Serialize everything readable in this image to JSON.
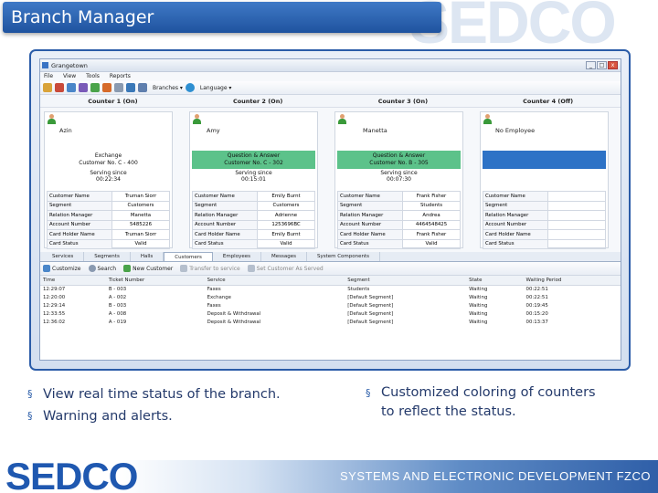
{
  "header": {
    "title": "Branch Manager",
    "watermark": "SEDCO"
  },
  "app": {
    "window_title": "Grangetown",
    "window_buttons": [
      "_",
      "□",
      "x"
    ],
    "menu": [
      "File",
      "View",
      "Tools",
      "Reports"
    ],
    "toolbar": {
      "branches": "Branches ▾",
      "language": "Language ▾"
    },
    "counters": [
      "Counter 1 (On)",
      "Counter 2 (On)",
      "Counter 3 (On)",
      "Counter 4 (Off)"
    ],
    "panels": [
      {
        "name": "Azin",
        "status_lines": [
          "Exchange",
          "Customer No. C - 400"
        ],
        "status_color": "#ffffff",
        "serving_label": "Serving since",
        "serving_time": "00:22:34",
        "rows": [
          [
            "Customer Name",
            "Truman Siorr"
          ],
          [
            "Segment",
            "Customers"
          ],
          [
            "Relation Manager",
            "Manetta"
          ],
          [
            "Account Number",
            "5485226"
          ],
          [
            "Card Holder Name",
            "Truman Siorr"
          ],
          [
            "Card Status",
            "Valid"
          ]
        ]
      },
      {
        "name": "Amy",
        "status_lines": [
          "Question & Answer",
          "Customer No. C - 302"
        ],
        "status_color": "#5cc28a",
        "serving_label": "Serving since",
        "serving_time": "00:15:01",
        "rows": [
          [
            "Customer Name",
            "Emily Burnt"
          ],
          [
            "Segment",
            "Customers"
          ],
          [
            "Relation Manager",
            "Adrienne"
          ],
          [
            "Account Number",
            "1253696BC"
          ],
          [
            "Card Holder Name",
            "Emily Burnt"
          ],
          [
            "Card Status",
            "Valid"
          ]
        ]
      },
      {
        "name": "Manetta",
        "status_lines": [
          "Question & Answer",
          "Customer No. B - 305"
        ],
        "status_color": "#5cc28a",
        "serving_label": "Serving since",
        "serving_time": "00:07:30",
        "rows": [
          [
            "Customer Name",
            "Frank Fisher"
          ],
          [
            "Segment",
            "Students"
          ],
          [
            "Relation Manager",
            "Andrea"
          ],
          [
            "Account Number",
            "4464548425"
          ],
          [
            "Card Holder Name",
            "Frank Fisher"
          ],
          [
            "Card Status",
            "Valid"
          ]
        ]
      },
      {
        "name": "No Employee",
        "status_lines": [
          "",
          ""
        ],
        "status_color": "#2d72c6",
        "serving_label": "",
        "serving_time": "",
        "rows": [
          [
            "Customer Name",
            ""
          ],
          [
            "Segment",
            ""
          ],
          [
            "Relation Manager",
            ""
          ],
          [
            "Account Number",
            ""
          ],
          [
            "Card Holder Name",
            ""
          ],
          [
            "Card Status",
            ""
          ]
        ]
      }
    ],
    "tabs": [
      "Services",
      "Segments",
      "Halls",
      "Customers",
      "Employees",
      "Messages",
      "System Components"
    ],
    "active_tab": "Customers",
    "commands": [
      "Customize",
      "Search",
      "New Customer",
      "Transfer to service",
      "Set Customer As Served"
    ],
    "grid": {
      "columns": [
        "Time",
        "Ticket Number",
        "Service",
        "Segment",
        "State",
        "Waiting Period"
      ],
      "rows": [
        [
          "12:29:07",
          "B - 003",
          "Faxes",
          "Students",
          "Waiting",
          "00:22:51"
        ],
        [
          "12:20:00",
          "A - 002",
          "Exchange",
          "[Default Segment]",
          "Waiting",
          "00:22:51"
        ],
        [
          "12:29:14",
          "B - 003",
          "Faxes",
          "[Default Segment]",
          "Waiting",
          "00:19:45"
        ],
        [
          "12:33:55",
          "A - 008",
          "Deposit & Withdrawal",
          "[Default Segment]",
          "Waiting",
          "00:15:20"
        ],
        [
          "12:36:02",
          "A - 019",
          "Deposit & Withdrawal",
          "[Default Segment]",
          "Waiting",
          "00:13:37"
        ]
      ]
    }
  },
  "bullets_left": [
    "View real time status of the branch.",
    "Warning and alerts."
  ],
  "bullets_right": [
    "Customized coloring of counters",
    "to reflect the status."
  ],
  "footer": {
    "logo": "SEDCO",
    "tagline": "SYSTEMS AND ELECTRONIC DEVELOPMENT FZCO"
  }
}
